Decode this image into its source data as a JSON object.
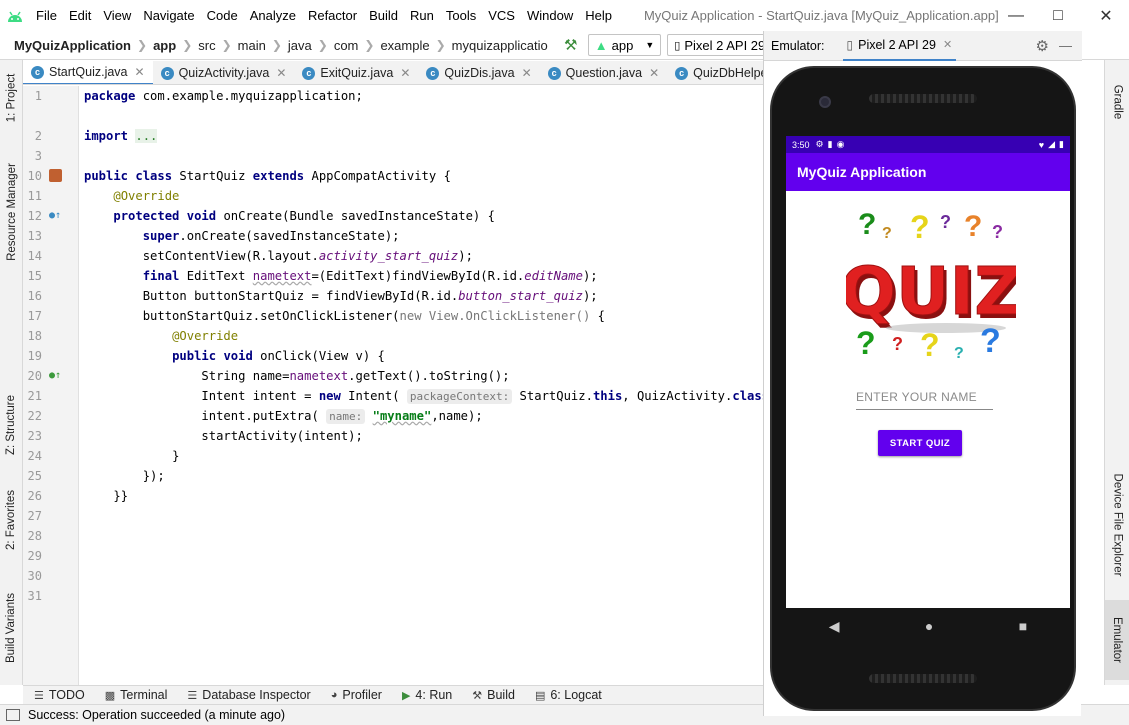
{
  "menu": [
    "File",
    "Edit",
    "View",
    "Navigate",
    "Code",
    "Analyze",
    "Refactor",
    "Build",
    "Run",
    "Tools",
    "VCS",
    "Window",
    "Help"
  ],
  "window_title": "MyQuiz Application - StartQuiz.java [MyQuiz_Application.app]",
  "breadcrumb": [
    "MyQuizApplication",
    "app",
    "src",
    "main",
    "java",
    "com",
    "example",
    "myquizapplicatio"
  ],
  "toolbar": {
    "run_config": "app",
    "device": "Pixel 2 API 29"
  },
  "left_tabs": {
    "project": "1: Project",
    "resource_manager": "Resource Manager",
    "structure": "Z: Structure",
    "favorites": "2: Favorites",
    "build_variants": "Build Variants"
  },
  "right_tabs": {
    "gradle": "Gradle",
    "device_file_explorer": "Device File Explorer",
    "emulator": "Emulator"
  },
  "editor_tabs": [
    "StartQuiz.java",
    "QuizActivity.java",
    "ExitQuiz.java",
    "QuizDis.java",
    "Question.java",
    "QuizDbHelper.java"
  ],
  "line_numbers": [
    "1",
    "2",
    "3",
    "10",
    "11",
    "12",
    "13",
    "14",
    "15",
    "16",
    "17",
    "18",
    "19",
    "20",
    "21",
    "22",
    "23",
    "24",
    "25",
    "26",
    "27",
    "28",
    "29",
    "30",
    "31"
  ],
  "code": {
    "l1": {
      "kw": "package",
      "rest": " com.example.myquizapplication;"
    },
    "l3": {
      "kw": "import",
      "fold": "..."
    },
    "l11": {
      "a": "public",
      "b": "class",
      "c": " StartQuiz ",
      "d": "extends",
      "e": " AppCompatActivity {"
    },
    "l12": {
      "ann": "@Override"
    },
    "l13": {
      "a": "protected",
      "b": "void",
      "c": " onCreate(Bundle savedInstanceState) {"
    },
    "l14": {
      "kw": "super",
      "rest": ".onCreate(savedInstanceState);"
    },
    "l15": {
      "pre": "setContentView(R.layout.",
      "it": "activity_start_quiz",
      "post": ");"
    },
    "l16": {
      "kw": "final",
      "a": " EditText ",
      "var": "nametext",
      "b": "=(EditText)findViewById(R.id.",
      "it": "editName",
      "post": ");"
    },
    "l17": {
      "pre": "Button buttonStartQuiz = findViewById(R.id.",
      "it": "button_start_quiz",
      "post": ");"
    },
    "l18": {
      "pre": "buttonStartQuiz.setOnClickListener(",
      "gray": "new View.OnClickListener()",
      "post": " {"
    },
    "l19": {
      "ann": "@Override"
    },
    "l20": {
      "a": "public",
      "b": "void",
      "c": " onClick(View v) {"
    },
    "l21": {
      "pre": "String name=",
      "var": "nametext",
      "post": ".getText().toString();"
    },
    "l22": {
      "pre": "Intent intent = ",
      "kw": "new",
      "mid": " Intent( ",
      "hint": "packageContext:",
      "mid2": " StartQuiz.",
      "kw2": "this",
      "mid3": ", QuizActivity.",
      "kw3": "class",
      "post": ");"
    },
    "l23": {
      "pre": "intent.putExtra( ",
      "hint": "name:",
      "str": "\"myname\"",
      "post": ",name);"
    },
    "l24": {
      "pre": "startActivity(intent);"
    },
    "l25": {
      "pre": "}"
    },
    "l26": {
      "pre": "});"
    },
    "l27": {
      "pre": "}}"
    }
  },
  "bottom_tools": [
    "TODO",
    "Terminal",
    "Database Inspector",
    "Profiler",
    "4: Run",
    "Build",
    "6: Logcat"
  ],
  "status": "Success: Operation succeeded (a minute ago)",
  "emulator": {
    "label": "Emulator:",
    "device_tab": "Pixel 2 API 29",
    "phone": {
      "time": "3:50",
      "app_title": "MyQuiz Application",
      "image_text": "QUIZ",
      "input_placeholder": "ENTER YOUR NAME",
      "button_label": "START QUIZ"
    }
  },
  "colors": {
    "primary": "#6200ee",
    "primary_dark": "#3700b3",
    "accent": "#4083c9"
  }
}
